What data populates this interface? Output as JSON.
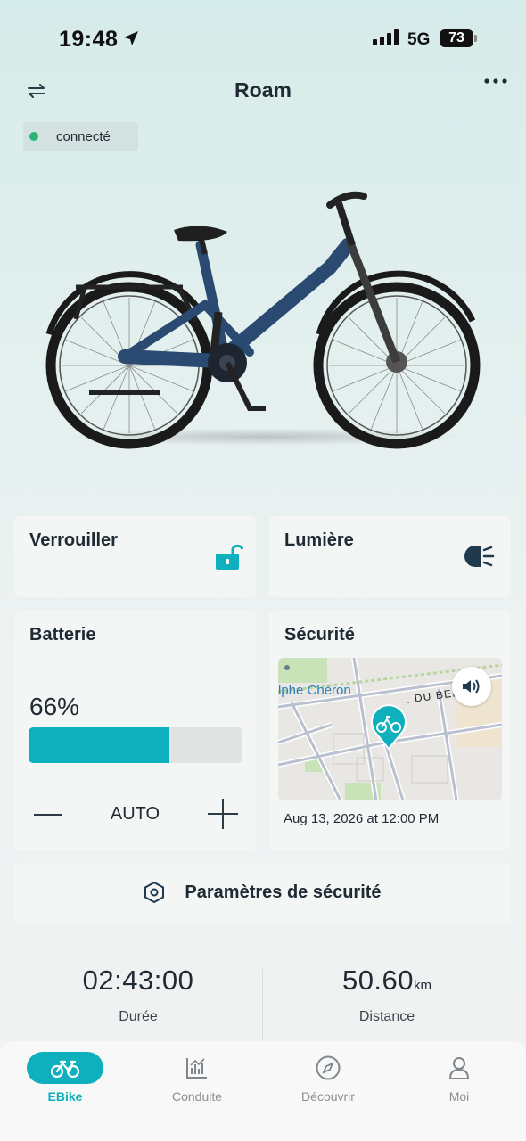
{
  "status_bar": {
    "time": "19:48",
    "network": "5G",
    "battery": "73"
  },
  "header": {
    "title": "Roam"
  },
  "connection": {
    "status": "connecté",
    "color": "#29b574"
  },
  "cards": {
    "lock": {
      "title": "Verrouiller"
    },
    "light": {
      "title": "Lumière"
    },
    "battery": {
      "title": "Batterie",
      "percent_label": "66%",
      "percent_value": 66,
      "mode": "AUTO"
    },
    "security": {
      "title": "Sécurité",
      "map_street_1": "lphe Chéron",
      "map_street_2": ". DU BEL AIR",
      "timestamp": "Aug 13, 2026 at 12:00 PM"
    }
  },
  "security_settings": {
    "label": "Paramètres de sécurité"
  },
  "stats": {
    "duration": {
      "value": "02:43:00",
      "label": "Durée"
    },
    "distance": {
      "value": "50.60",
      "unit": "km",
      "label": "Distance"
    }
  },
  "tabs": [
    {
      "label": "EBike",
      "icon": "bike-icon",
      "active": true
    },
    {
      "label": "Conduite",
      "icon": "chart-icon",
      "active": false
    },
    {
      "label": "Découvrir",
      "icon": "compass-icon",
      "active": false
    },
    {
      "label": "Moi",
      "icon": "user-icon",
      "active": false
    }
  ],
  "colors": {
    "accent": "#0fb0bd",
    "text": "#1f2a33"
  }
}
